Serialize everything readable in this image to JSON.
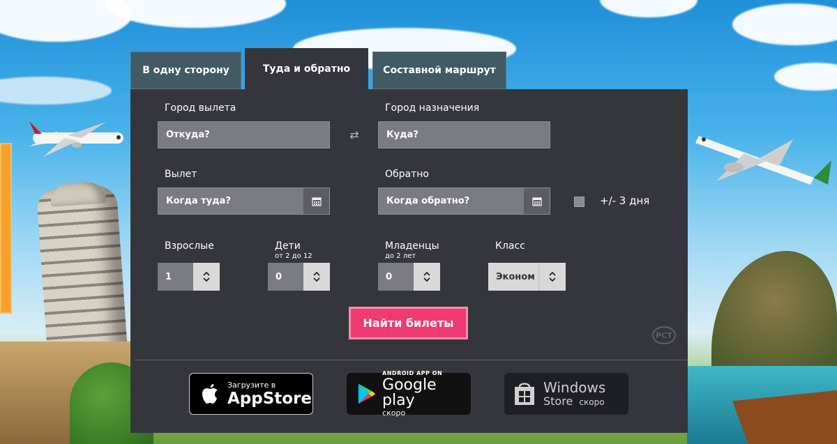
{
  "tabs": [
    {
      "label": "В одну сторону",
      "active": false
    },
    {
      "label": "Туда и обратно",
      "active": true
    },
    {
      "label": "Составной маршрут",
      "active": false
    }
  ],
  "form": {
    "origin_label": "Город вылета",
    "origin_placeholder": "Откуда?",
    "destination_label": "Город назначения",
    "destination_placeholder": "Куда?",
    "depart_label": "Вылет",
    "depart_placeholder": "Когда туда?",
    "return_label": "Обратно",
    "return_placeholder": "Когда обратно?",
    "flex_days_label": "+/- 3 дня",
    "adults_label": "Взрослые",
    "adults_value": "1",
    "children_label": "Дети",
    "children_sub": "от 2 до 12",
    "children_value": "0",
    "infants_label": "Младенцы",
    "infants_sub": "до 2 лет",
    "infants_value": "0",
    "class_label": "Класс",
    "class_value": "Эконом",
    "search_button": "Найти билеты"
  },
  "stores": {
    "apple_top": "Загрузите в",
    "apple_main": "AppStore",
    "google_top": "ANDROID APP ON",
    "google_main": "Google play",
    "google_soon": "скоро",
    "windows_line1": "Windows",
    "windows_line2": "Store",
    "windows_soon": "скоро"
  },
  "colors": {
    "panel": "#35363b",
    "tab_inactive": "#415a63",
    "accent": "#f03a72"
  }
}
